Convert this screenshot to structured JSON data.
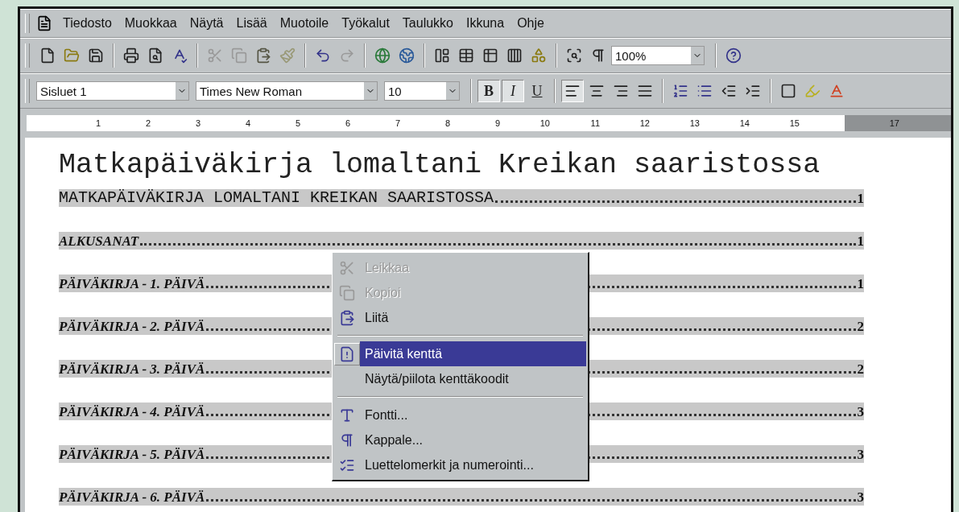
{
  "menu_bar": [
    {
      "label": "Tiedosto"
    },
    {
      "label": "Muokkaa"
    },
    {
      "label": "Näytä"
    },
    {
      "label": "Lisää"
    },
    {
      "label": "Muotoile"
    },
    {
      "label": "Työkalut"
    },
    {
      "label": "Taulukko"
    },
    {
      "label": "Ikkuna"
    },
    {
      "label": "Ohje"
    }
  ],
  "standard_toolbar": {
    "zoom": "100%"
  },
  "formatting_toolbar": {
    "style": "Sisluet 1",
    "font": "Times New Roman",
    "size": "10",
    "text_buttons": [
      {
        "label": "B",
        "kind": "bold",
        "pressed": true
      },
      {
        "label": "I",
        "kind": "italic",
        "pressed": true
      },
      {
        "label": "U",
        "kind": "underline",
        "pressed": false
      }
    ],
    "align_buttons": [
      {
        "kind": "left",
        "pressed": true
      },
      {
        "kind": "center",
        "pressed": false
      },
      {
        "kind": "right",
        "pressed": false
      },
      {
        "kind": "justify",
        "pressed": false
      }
    ]
  },
  "ruler": [
    "1",
    "2",
    "3",
    "4",
    "5",
    "6",
    "7",
    "8",
    "9",
    "10",
    "11",
    "12",
    "13",
    "14",
    "15",
    "17"
  ],
  "document": {
    "title": "Matkapäiväkirja lomaltani Kreikan saaristossa",
    "toc": [
      {
        "text": "MATKAPÄIVÄKIRJA LOMALTANI KREIKAN SAARISTOSSA",
        "page": "1",
        "kind": "heading"
      },
      {
        "text": "ALKUSANAT",
        "page": "1",
        "kind": "entry"
      },
      {
        "text": "PÄIVÄKIRJA - 1. PÄIVÄ",
        "page": "1",
        "kind": "entry"
      },
      {
        "text": "PÄIVÄKIRJA - 2. PÄIVÄ",
        "page": "2",
        "kind": "entry"
      },
      {
        "text": "PÄIVÄKIRJA - 3. PÄIVÄ",
        "page": "2",
        "kind": "entry"
      },
      {
        "text": "PÄIVÄKIRJA - 4. PÄIVÄ",
        "page": "3",
        "kind": "entry"
      },
      {
        "text": "PÄIVÄKIRJA - 5. PÄIVÄ",
        "page": "3",
        "kind": "entry"
      },
      {
        "text": "PÄIVÄKIRJA - 6. PÄIVÄ",
        "page": "3",
        "kind": "entry"
      }
    ]
  },
  "context_menu": [
    {
      "kind": "item",
      "label": "Leikkaa",
      "disabled": true,
      "selected": false
    },
    {
      "kind": "item",
      "label": "Kopioi",
      "disabled": true,
      "selected": false
    },
    {
      "kind": "item",
      "label": "Liitä",
      "disabled": false,
      "selected": false
    },
    {
      "kind": "separator"
    },
    {
      "kind": "item",
      "label": "Päivitä kenttä",
      "disabled": false,
      "selected": true
    },
    {
      "kind": "item",
      "label": "Näytä/piilota kenttäkoodit",
      "disabled": false,
      "selected": false
    },
    {
      "kind": "separator"
    },
    {
      "kind": "item",
      "label": "Fontti...",
      "disabled": false,
      "selected": false
    },
    {
      "kind": "item",
      "label": "Kappale...",
      "disabled": false,
      "selected": false
    },
    {
      "kind": "item",
      "label": "Luettelomerkit ja numerointi...",
      "disabled": false,
      "selected": false
    }
  ]
}
